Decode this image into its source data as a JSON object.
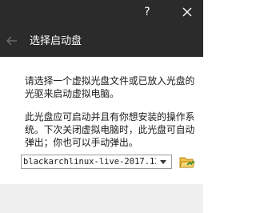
{
  "window": {
    "help_label": "?",
    "close_icon": "close-icon"
  },
  "header": {
    "title": "选择启动盘",
    "back_icon": "back-arrow-icon"
  },
  "body": {
    "paragraph1": "请选择一个虚拟光盘文件或已放入光盘的光驱来启动虚拟电脑。",
    "paragraph2": "此光盘应可启动并且有你想安装的操作系统。下次关闭虚拟电脑时，此光盘可自动弹出；你也可以手动弹出。"
  },
  "disk_select": {
    "selected": "blackarchlinux-live-2017.12.",
    "arrow_icon": "chevron-down-icon"
  },
  "folder_button": {
    "icon": "folder-open-icon"
  },
  "colors": {
    "titlebar": "#2b2b2b",
    "footer": "#f0f0f0",
    "folder_accent": "#e8a81e"
  }
}
